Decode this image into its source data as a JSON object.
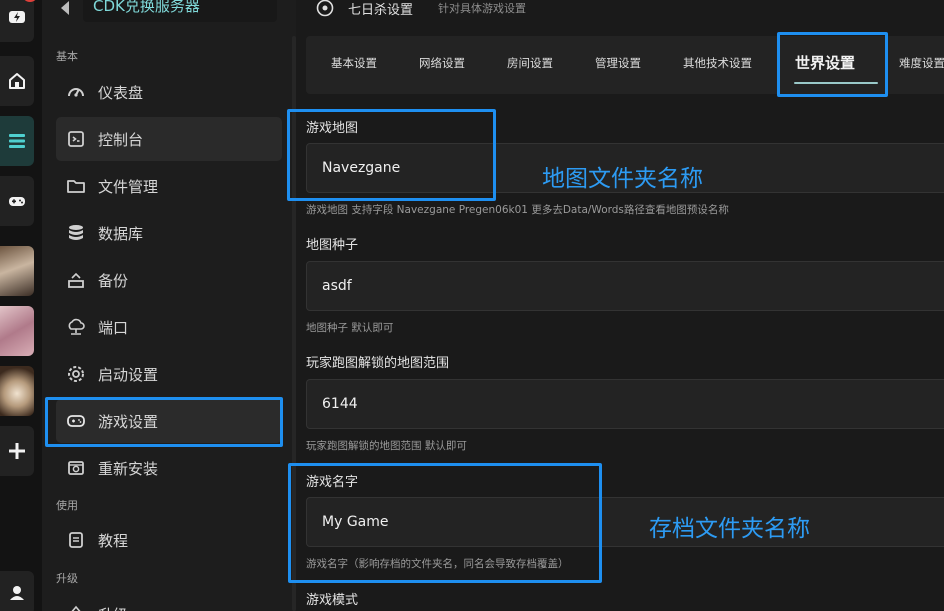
{
  "rail": {
    "badge": "!",
    "icons": [
      "lightning-icon",
      "home-icon",
      "server-icon",
      "gamepad-icon",
      "avatar-1",
      "avatar-2",
      "avatar-3",
      "plus-icon",
      "user-icon"
    ]
  },
  "sidebar": {
    "server_title": "CDK兑换服务器",
    "groups": {
      "basic": "基本",
      "use": "使用",
      "upgrade": "升级"
    },
    "items": [
      {
        "label": "仪表盘",
        "icon": "gauge-icon"
      },
      {
        "label": "控制台",
        "icon": "terminal-icon"
      },
      {
        "label": "文件管理",
        "icon": "folder-icon"
      },
      {
        "label": "数据库",
        "icon": "database-icon"
      },
      {
        "label": "备份",
        "icon": "backup-icon"
      },
      {
        "label": "端口",
        "icon": "network-icon"
      },
      {
        "label": "启动设置",
        "icon": "gear-icon"
      },
      {
        "label": "游戏设置",
        "icon": "gamepad-icon"
      },
      {
        "label": "重新安装",
        "icon": "reinstall-icon"
      },
      {
        "label": "教程",
        "icon": "document-icon"
      },
      {
        "label": "升级",
        "icon": "upgrade-icon"
      }
    ]
  },
  "header": {
    "title": "七日杀设置",
    "subtitle": "针对具体游戏设置"
  },
  "tabs": [
    "基本设置",
    "网络设置",
    "房间设置",
    "管理设置",
    "其他技术设置",
    "世界设置",
    "难度设置"
  ],
  "active_tab": "世界设置",
  "fields": [
    {
      "label": "游戏地图",
      "value": "Navezgane",
      "hint": "游戏地图 支持字段 Navezgane Pregen06k01 更多去Data/Words路径查看地图预设名称"
    },
    {
      "label": "地图种子",
      "value": "asdf",
      "hint": "地图种子 默认即可"
    },
    {
      "label": "玩家跑图解锁的地图范围",
      "value": "6144",
      "hint": "玩家跑图解锁的地图范围 默认即可"
    },
    {
      "label": "游戏名字",
      "value": "My Game",
      "hint": "游戏名字（影响存档的文件夹名，同名会导致存档覆盖）"
    },
    {
      "label": "游戏模式"
    }
  ],
  "annotations": {
    "map_folder": "地图文件夹名称",
    "save_folder": "存档文件夹名称"
  },
  "colors": {
    "accent": "#1e8ff0",
    "title_accent": "#7fd8d8",
    "badge": "#e0403a"
  }
}
